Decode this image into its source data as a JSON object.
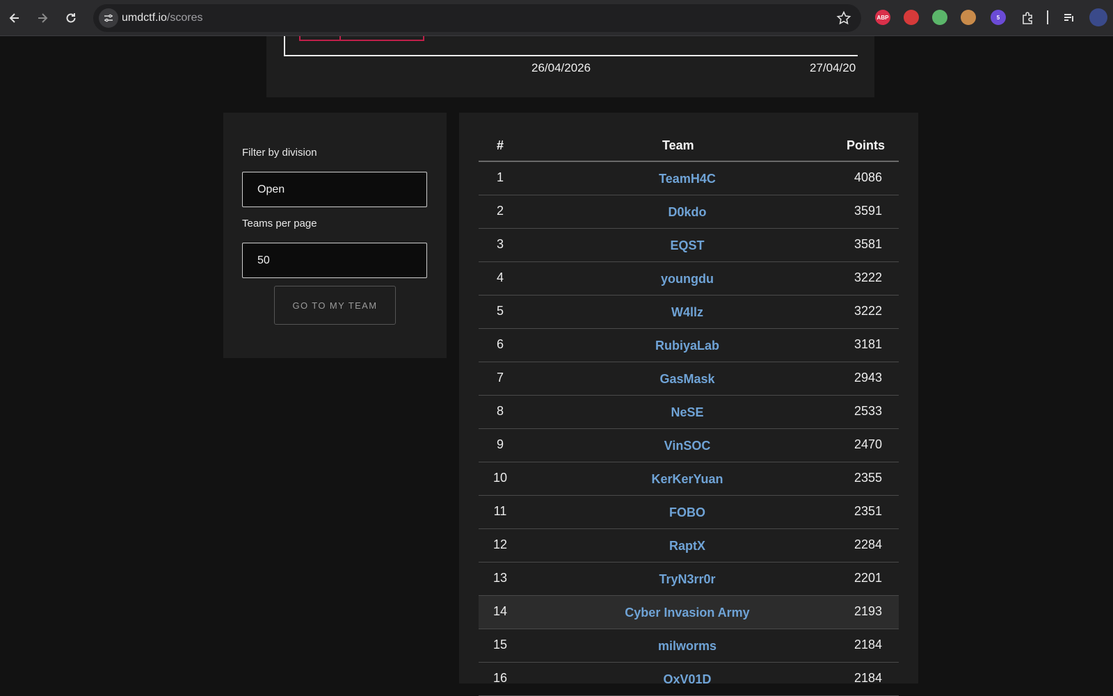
{
  "browser": {
    "url_host": "umdctf.io",
    "url_path": "/scores",
    "extensions": [
      {
        "icon": "adblock-plus-icon",
        "color": "#d9304a",
        "text": "ABP"
      },
      {
        "icon": "hand-stop-icon",
        "color": "#d63a3a",
        "text": ""
      },
      {
        "icon": "shield-check-icon",
        "color": "#5bb66a",
        "text": ""
      },
      {
        "icon": "cookie-icon",
        "color": "#c98b4a",
        "text": ""
      },
      {
        "icon": "extension-badge-icon",
        "color": "#6b4bd6",
        "text": "5"
      }
    ]
  },
  "chart": {
    "x_ticks": [
      "26/04/2026",
      "27/04/20"
    ]
  },
  "filter": {
    "division_label": "Filter by division",
    "division_value": "Open",
    "per_page_label": "Teams per page",
    "per_page_value": "50",
    "goto_label": "GO TO MY TEAM"
  },
  "scoreboard": {
    "col_rank": "#",
    "col_team": "Team",
    "col_points": "Points",
    "rows": [
      {
        "rank": "1",
        "team": "TeamH4C",
        "points": "4086"
      },
      {
        "rank": "2",
        "team": "D0kdo",
        "points": "3591"
      },
      {
        "rank": "3",
        "team": "EQST",
        "points": "3581"
      },
      {
        "rank": "4",
        "team": "youngdu",
        "points": "3222"
      },
      {
        "rank": "5",
        "team": "W4llz",
        "points": "3222"
      },
      {
        "rank": "6",
        "team": "RubiyaLab",
        "points": "3181"
      },
      {
        "rank": "7",
        "team": "GasMask",
        "points": "2943"
      },
      {
        "rank": "8",
        "team": "NeSE",
        "points": "2533"
      },
      {
        "rank": "9",
        "team": "VinSOC",
        "points": "2470"
      },
      {
        "rank": "10",
        "team": "KerKerYuan",
        "points": "2355"
      },
      {
        "rank": "11",
        "team": "FOBO",
        "points": "2351"
      },
      {
        "rank": "12",
        "team": "RaptX",
        "points": "2284"
      },
      {
        "rank": "13",
        "team": "TryN3rr0r",
        "points": "2201"
      },
      {
        "rank": "14",
        "team": "Cyber Invasion Army",
        "points": "2193"
      },
      {
        "rank": "15",
        "team": "milworms",
        "points": "2184"
      },
      {
        "rank": "16",
        "team": "OxV01D",
        "points": "2184"
      }
    ]
  },
  "colors": {
    "team_link": "#6fa3d6",
    "chart_line": "#c0204a",
    "card_bg": "#1e1e1e",
    "page_bg": "#121212"
  }
}
